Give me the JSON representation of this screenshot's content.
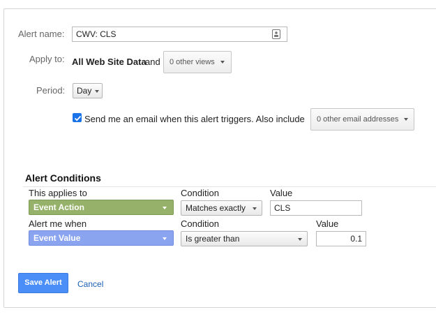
{
  "form": {
    "alert_name_label": "Alert name:",
    "alert_name_value": "CWV: CLS",
    "apply_to_label": "Apply to:",
    "apply_to_value": "All Web Site Data",
    "apply_to_and": "and",
    "views_dropdown": "0 other views",
    "period_label": "Period:",
    "period_value": "Day",
    "email_checked": true,
    "email_text": "Send me an email when this alert triggers. Also include",
    "email_dropdown": "0 other email addresses"
  },
  "conditions": {
    "title": "Alert Conditions",
    "applies_to_header": "This applies to",
    "condition_header_1": "Condition",
    "value_header_1": "Value",
    "applies_to_value": "Event Action",
    "condition_1_value": "Matches exactly",
    "value_1": "CLS",
    "alert_me_when_header": "Alert me when",
    "condition_header_2": "Condition",
    "value_header_2": "Value",
    "alert_me_when_value": "Event Value",
    "condition_2_value": "Is greater than",
    "value_2": "0.1"
  },
  "actions": {
    "save_label": "Save Alert",
    "cancel_label": "Cancel"
  },
  "icons": {
    "contact_card": "contact-card-icon",
    "checkmark": "checkmark-icon",
    "caret": "caret-down-icon"
  },
  "colors": {
    "accent_blue": "#4c8ef7",
    "dimension_green": "#96b26a",
    "metric_blue": "#8aa4f0",
    "link": "#1a5fb4"
  }
}
